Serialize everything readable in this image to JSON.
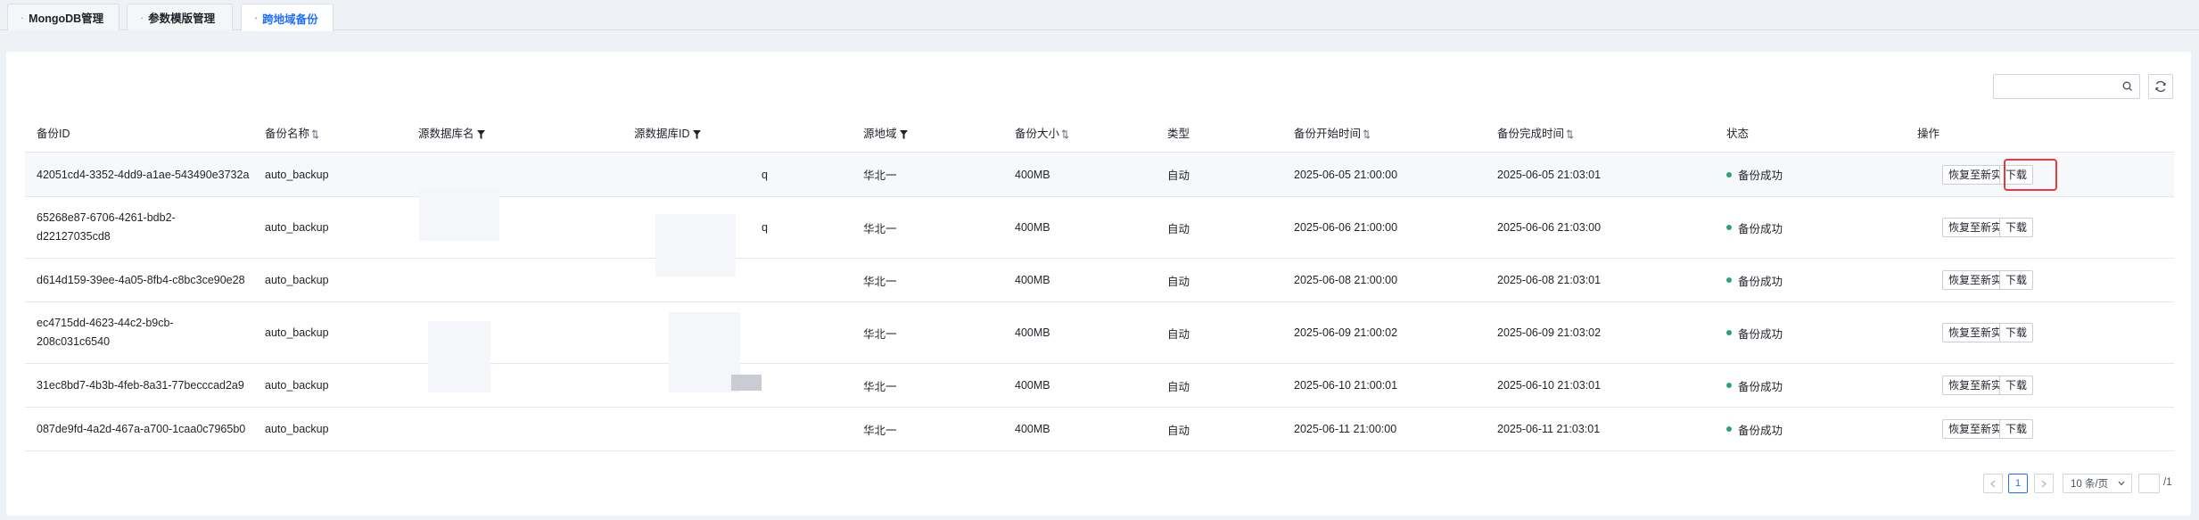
{
  "tabs": [
    {
      "label": "MongoDB管理",
      "active": false
    },
    {
      "label": "参数模版管理",
      "active": false
    },
    {
      "label": "跨地域备份",
      "active": true
    }
  ],
  "toolbar": {
    "search_placeholder": "",
    "search_icon": "search-icon",
    "refresh_icon": "refresh-icon"
  },
  "table": {
    "columns": [
      "备份ID",
      "备份名称",
      "源数据库名",
      "源数据库ID",
      "源地域",
      "备份大小",
      "类型",
      "备份开始时间",
      "备份完成时间",
      "状态",
      "操作"
    ],
    "rows": [
      {
        "id": "42051cd4-3352-4dd9-a1ae-543490e3732a",
        "name": "auto_backup",
        "db_name": "",
        "db_id": "q",
        "region": "华北一",
        "size": "400MB",
        "type": "自动",
        "start": "2025-06-05 21:00:00",
        "end": "2025-06-05 21:03:01",
        "status": "备份成功"
      },
      {
        "id": "65268e87-6706-4261-bdb2-d22127035cd8",
        "name": "auto_backup",
        "db_name": "",
        "db_id": "q",
        "region": "华北一",
        "size": "400MB",
        "type": "自动",
        "start": "2025-06-06 21:00:00",
        "end": "2025-06-06 21:03:00",
        "status": "备份成功"
      },
      {
        "id": "d614d159-39ee-4a05-8fb4-c8bc3ce90e28",
        "name": "auto_backup",
        "db_name": "",
        "db_id": "",
        "region": "华北一",
        "size": "400MB",
        "type": "自动",
        "start": "2025-06-08 21:00:00",
        "end": "2025-06-08 21:03:01",
        "status": "备份成功"
      },
      {
        "id": "ec4715dd-4623-44c2-b9cb-208c031c6540",
        "name": "auto_backup",
        "db_name": "",
        "db_id": "",
        "region": "华北一",
        "size": "400MB",
        "type": "自动",
        "start": "2025-06-09 21:00:02",
        "end": "2025-06-09 21:03:02",
        "status": "备份成功"
      },
      {
        "id": "31ec8bd7-4b3b-4feb-8a31-77becccad2a9",
        "name": "auto_backup",
        "db_name": "",
        "db_id": "",
        "region": "华北一",
        "size": "400MB",
        "type": "自动",
        "start": "2025-06-10 21:00:01",
        "end": "2025-06-10 21:03:01",
        "status": "备份成功"
      },
      {
        "id": "087de9fd-4a2d-467a-a700-1caa0c7965b0",
        "name": "auto_backup",
        "db_name": "",
        "db_id": "",
        "region": "华北一",
        "size": "400MB",
        "type": "自动",
        "start": "2025-06-11 21:00:00",
        "end": "2025-06-11 21:03:01",
        "status": "备份成功"
      }
    ],
    "actions": {
      "restore": "恢复至新实例",
      "download": "下载"
    }
  },
  "pagination": {
    "current_page": "1",
    "page_size": "10 条/页",
    "total_pages": "/1"
  },
  "colors": {
    "accent": "#1f6fff",
    "success": "#2ba471",
    "highlight": "#e23b3b"
  }
}
